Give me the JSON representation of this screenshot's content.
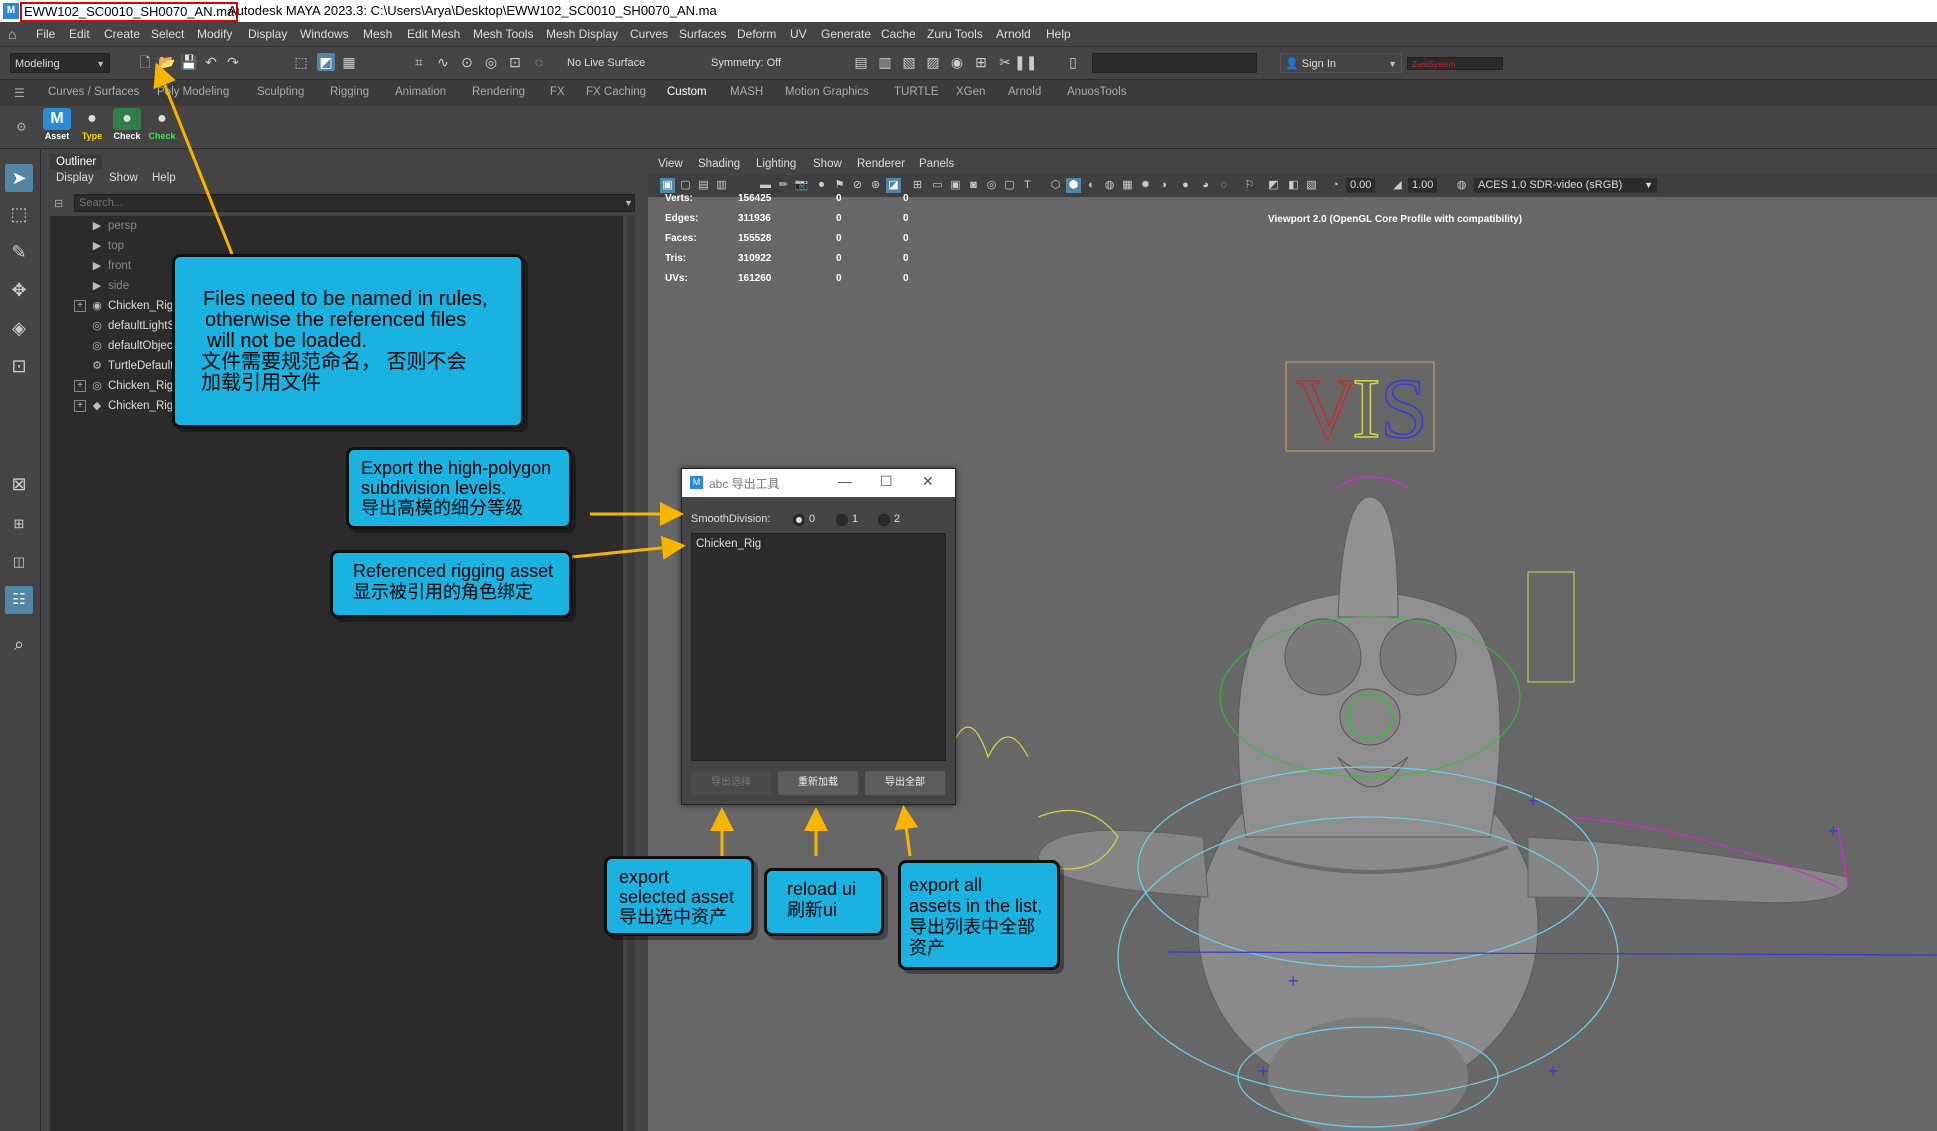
{
  "titlebar": {
    "file_name": "EWW102_SC0010_SH0070_AN.ma",
    "title": "Autodesk MAYA 2023.3: C:\\Users\\Arya\\Desktop\\EWW102_SC0010_SH0070_AN.ma"
  },
  "menubar": {
    "items": [
      "File",
      "Edit",
      "Create",
      "Select",
      "Modify",
      "Display",
      "Windows",
      "Mesh",
      "Edit Mesh",
      "Mesh Tools",
      "Mesh Display",
      "Curves",
      "Surfaces",
      "Deform",
      "UV",
      "Generate",
      "Cache",
      "Zuru Tools",
      "Arnold",
      "Help"
    ]
  },
  "statusline": {
    "mode": "Modeling",
    "live_surface": "No Live Surface",
    "symmetry": "Symmetry: Off",
    "sign_in": "Sign In",
    "zuru": "ZuruSystem"
  },
  "shelf": {
    "tabs": [
      "Curves / Surfaces",
      "Poly Modeling",
      "Sculpting",
      "Rigging",
      "Animation",
      "Rendering",
      "FX",
      "FX Caching",
      "Custom",
      "MASH",
      "Motion Graphics",
      "TURTLE",
      "XGen",
      "Arnold",
      "AnuosTools"
    ],
    "active_tab": "Custom",
    "buttons": [
      {
        "label": "Asset",
        "glyph": "M",
        "color": "#2a8ad6"
      },
      {
        "label": "Type",
        "glyph": "🐍",
        "color": "#3b3b3b"
      },
      {
        "label": "Check",
        "glyph": "🐍",
        "color": "#2f7e4b"
      },
      {
        "label": "Check",
        "glyph": "🐍",
        "color": "#3b3b3b"
      }
    ]
  },
  "outliner": {
    "tab": "Outliner",
    "menu": [
      "Display",
      "Show",
      "Help"
    ],
    "search_placeholder": "Search...",
    "rows": [
      {
        "name": "persp",
        "icon": "camera-icon",
        "expand": false,
        "dim": true
      },
      {
        "name": "top",
        "icon": "camera-icon",
        "expand": false,
        "dim": true
      },
      {
        "name": "front",
        "icon": "camera-icon",
        "expand": false,
        "dim": true
      },
      {
        "name": "side",
        "icon": "camera-icon",
        "expand": false,
        "dim": true
      },
      {
        "name": "Chicken_Rig:",
        "icon": "reference-icon",
        "expand": true,
        "dim": false
      },
      {
        "name": "defaultLightS",
        "icon": "set-icon",
        "expand": false,
        "dim": false
      },
      {
        "name": "defaultObjec",
        "icon": "set-icon",
        "expand": false,
        "dim": false
      },
      {
        "name": "TurtleDefault",
        "icon": "node-icon",
        "expand": false,
        "dim": false
      },
      {
        "name": "Chicken_Rig:",
        "icon": "set-icon",
        "expand": true,
        "dim": false
      },
      {
        "name": "Chicken_RigR",
        "icon": "diamond-icon",
        "expand": true,
        "dim": false
      }
    ]
  },
  "viewport": {
    "menu": [
      "View",
      "Shading",
      "Lighting",
      "Show",
      "Renderer",
      "Panels"
    ],
    "exposure": "0.00",
    "gamma": "1.00",
    "colorspace": "ACES 1.0 SDR-video (sRGB)",
    "renderer_label": "Viewport 2.0 (OpenGL Core Profile with compatibility)",
    "stats": [
      {
        "label": "Verts:",
        "v": "156425",
        "a": "0",
        "b": "0"
      },
      {
        "label": "Edges:",
        "v": "311936",
        "a": "0",
        "b": "0"
      },
      {
        "label": "Faces:",
        "v": "155528",
        "a": "0",
        "b": "0"
      },
      {
        "label": "Tris:",
        "v": "310922",
        "a": "0",
        "b": "0"
      },
      {
        "label": "UVs:",
        "v": "161260",
        "a": "0",
        "b": "0"
      }
    ],
    "vis_text": "VIS"
  },
  "dialog": {
    "title": "abc 导出工具",
    "smooth_label": "SmoothDivision:",
    "smooth_options": [
      "0",
      "1",
      "2"
    ],
    "smooth_selected": "0",
    "list_items": [
      "Chicken_Rig"
    ],
    "buttons": {
      "export_selected": "导出选择",
      "reload": "重新加载",
      "export_all": "导出全部"
    }
  },
  "callouts": {
    "naming": [
      "Files need to be named in rules,",
      "otherwise the referenced files",
      "will not be loaded.",
      "文件需要规范命名，  否则不会",
      "加载引用文件"
    ],
    "subdiv": [
      "Export the high-polygon",
      "subdivision levels.",
      "导出高模的细分等级"
    ],
    "rigging": [
      "Referenced rigging asset",
      "显示被引用的角色绑定"
    ],
    "export_selected": [
      "export",
      "selected asset",
      "导出选中资产"
    ],
    "reload": [
      "reload ui",
      "刷新ui"
    ],
    "export_all": [
      "export all",
      "assets in the list,",
      "导出列表中全部",
      "资产"
    ]
  },
  "colors": {
    "callout": "#1ab2e0",
    "arrow": "#f7b500",
    "highlight": "#e00000",
    "selected": "#5285a6"
  }
}
